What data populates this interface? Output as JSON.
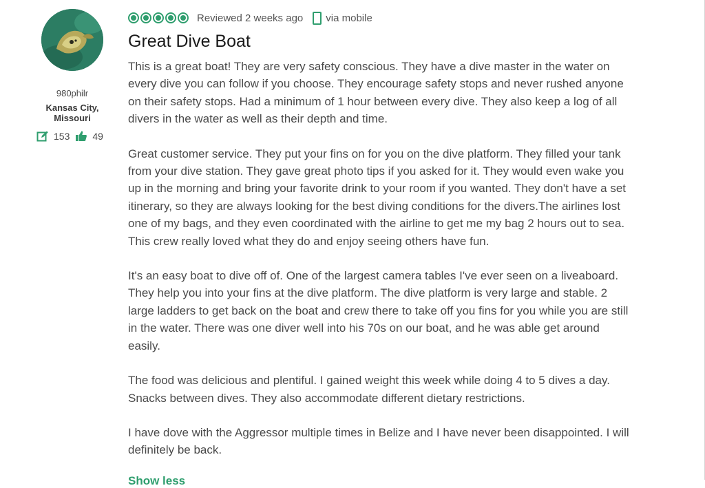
{
  "reviewer": {
    "username": "980philr",
    "location": "Kansas City, Missouri",
    "contributions": "153",
    "helpful_votes": "49",
    "avatar_icon": "avatar-photo-icon"
  },
  "review": {
    "rating": 5,
    "rating_max": 5,
    "bubble_color": "#2f9e6e",
    "reviewed": "Reviewed 2 weeks ago",
    "via": "via mobile",
    "title": "Great Dive Boat",
    "paragraphs": [
      "This is a great boat! They are very safety conscious. They have a dive master in the water on every dive you can follow if you choose. They encourage safety stops and never rushed anyone on their safety stops. Had a minimum of 1 hour between every dive. They also keep a log of all divers in the water as well as their depth and time.",
      "Great customer service. They put your fins on for you on the dive platform. They filled your tank from your dive station. They gave great photo tips if you asked for it. They would even wake you up in the morning and bring your favorite drink to your room if you wanted. They don't have a set itinerary, so they are always looking for the best diving conditions for the divers.The airlines lost one of my bags, and they even coordinated with the airline to get me my bag 2 hours out to sea. This crew really loved what they do and enjoy seeing others have fun.",
      "It's an easy boat to dive off of. One of the largest camera tables I've ever seen on a liveaboard. They help you into your fins at the dive platform. The dive platform is very large and stable. 2 large ladders to get back on the boat and crew there to take off you fins for you while you are still in the water. There was one diver well into his 70s on our boat, and he was able get around easily.",
      "The food was delicious and plentiful. I gained weight this week while doing 4 to 5 dives a day. Snacks between dives. They also accommodate different dietary restrictions.",
      "I have dove with the Aggressor multiple times in Belize and I have never been disappointed. I will definitely be back."
    ],
    "show_more": "Show less"
  }
}
